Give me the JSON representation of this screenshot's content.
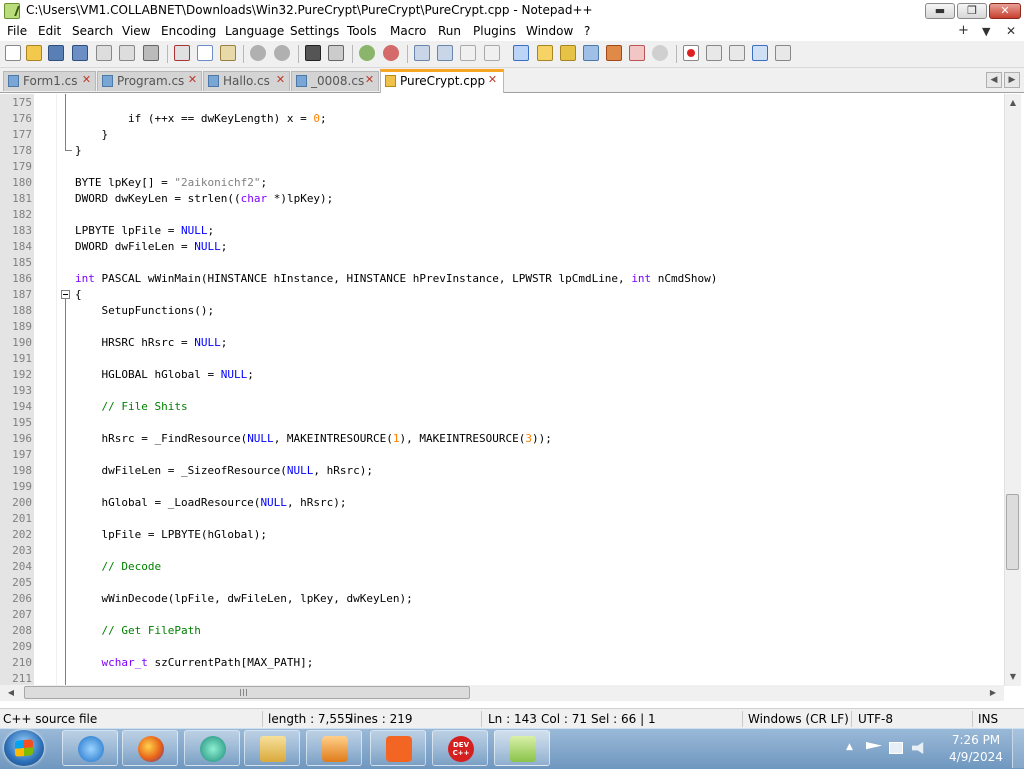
{
  "window": {
    "title": "C:\\Users\\VM1.COLLABNET\\Downloads\\Win32.PureCrypt\\PureCrypt\\PureCrypt.cpp - Notepad++",
    "min_label": "▬",
    "max_label": "❐",
    "close_label": "✕"
  },
  "menu": {
    "items": [
      "File",
      "Edit",
      "Search",
      "View",
      "Encoding",
      "Language",
      "Settings",
      "Tools",
      "Macro",
      "Run",
      "Plugins",
      "Window",
      "?"
    ],
    "right_plus": "+",
    "right_down": "▼",
    "right_close": "✕"
  },
  "tabs": [
    {
      "label": "Form1.cs",
      "active": false
    },
    {
      "label": "Program.cs",
      "active": false
    },
    {
      "label": "Hallo.cs",
      "active": false
    },
    {
      "label": "_0008.cs",
      "active": false
    },
    {
      "label": "PureCrypt.cpp",
      "active": true
    }
  ],
  "tab_close_glyph": "✕",
  "tab_scroll": {
    "left": "◀",
    "right": "▶"
  },
  "editor": {
    "line_numbers": [
      "175",
      "176",
      "177",
      "178",
      "179",
      "180",
      "181",
      "182",
      "183",
      "184",
      "185",
      "186",
      "187",
      "188",
      "189",
      "190",
      "191",
      "192",
      "193",
      "194",
      "195",
      "196",
      "197",
      "198",
      "199",
      "200",
      "201",
      "202",
      "203",
      "204",
      "205",
      "206",
      "207",
      "208",
      "209",
      "210",
      "211"
    ],
    "lines": [
      [],
      [
        {
          "t": "        if (++x == dwKeyLength) x = ",
          "c": ""
        },
        {
          "t": "0",
          "c": "num"
        },
        {
          "t": ";",
          "c": ""
        }
      ],
      [
        {
          "t": "    }",
          "c": ""
        }
      ],
      [
        {
          "t": "}",
          "c": ""
        }
      ],
      [],
      [
        {
          "t": "BYTE lpKey[] = ",
          "c": ""
        },
        {
          "t": "\"2aikonichf2\"",
          "c": "str"
        },
        {
          "t": ";",
          "c": ""
        }
      ],
      [
        {
          "t": "DWORD dwKeyLen = strlen((",
          "c": ""
        },
        {
          "t": "char",
          "c": "kw"
        },
        {
          "t": " *)lpKey);",
          "c": ""
        }
      ],
      [],
      [
        {
          "t": "LPBYTE lpFile = ",
          "c": ""
        },
        {
          "t": "NULL",
          "c": "nul"
        },
        {
          "t": ";",
          "c": ""
        }
      ],
      [
        {
          "t": "DWORD dwFileLen = ",
          "c": ""
        },
        {
          "t": "NULL",
          "c": "nul"
        },
        {
          "t": ";",
          "c": ""
        }
      ],
      [],
      [
        {
          "t": "int",
          "c": "kw"
        },
        {
          "t": " PASCAL wWinMain(HINSTANCE hInstance, HINSTANCE hPrevInstance, LPWSTR lpCmdLine, ",
          "c": ""
        },
        {
          "t": "int",
          "c": "kw"
        },
        {
          "t": " nCmdShow)",
          "c": ""
        }
      ],
      [
        {
          "t": "{",
          "c": ""
        }
      ],
      [
        {
          "t": "    SetupFunctions();",
          "c": ""
        }
      ],
      [],
      [
        {
          "t": "    HRSRC hRsrc = ",
          "c": ""
        },
        {
          "t": "NULL",
          "c": "nul"
        },
        {
          "t": ";",
          "c": ""
        }
      ],
      [],
      [
        {
          "t": "    HGLOBAL hGlobal = ",
          "c": ""
        },
        {
          "t": "NULL",
          "c": "nul"
        },
        {
          "t": ";",
          "c": ""
        }
      ],
      [],
      [
        {
          "t": "    // File Shits",
          "c": "cmt"
        }
      ],
      [],
      [
        {
          "t": "    hRsrc = _FindResource(",
          "c": ""
        },
        {
          "t": "NULL",
          "c": "nul"
        },
        {
          "t": ", MAKEINTRESOURCE(",
          "c": ""
        },
        {
          "t": "1",
          "c": "num"
        },
        {
          "t": "), MAKEINTRESOURCE(",
          "c": ""
        },
        {
          "t": "3",
          "c": "num"
        },
        {
          "t": "));",
          "c": ""
        }
      ],
      [],
      [
        {
          "t": "    dwFileLen = _SizeofResource(",
          "c": ""
        },
        {
          "t": "NULL",
          "c": "nul"
        },
        {
          "t": ", hRsrc);",
          "c": ""
        }
      ],
      [],
      [
        {
          "t": "    hGlobal = _LoadResource(",
          "c": ""
        },
        {
          "t": "NULL",
          "c": "nul"
        },
        {
          "t": ", hRsrc);",
          "c": ""
        }
      ],
      [],
      [
        {
          "t": "    lpFile = LPBYTE(hGlobal);",
          "c": ""
        }
      ],
      [],
      [
        {
          "t": "    // Decode",
          "c": "cmt"
        }
      ],
      [],
      [
        {
          "t": "    wWinDecode(lpFile, dwFileLen, lpKey, dwKeyLen);",
          "c": ""
        }
      ],
      [],
      [
        {
          "t": "    // Get FilePath",
          "c": "cmt"
        }
      ],
      [],
      [
        {
          "t": "    ",
          "c": ""
        },
        {
          "t": "wchar_t",
          "c": "kw"
        },
        {
          "t": " szCurrentPath[MAX_PATH];",
          "c": ""
        }
      ],
      []
    ]
  },
  "scroll": {
    "up": "▲",
    "down": "▼",
    "left": "◀",
    "right": "▶"
  },
  "status": {
    "file_type": "C++ source file",
    "length": "length : 7,555",
    "lines": "lines : 219",
    "ln": "Ln : 143",
    "col": "Col : 71",
    "sel": "Sel : 66 | 1",
    "eol": "Windows (CR LF)",
    "encoding": "UTF-8",
    "mode": "INS"
  },
  "taskbar": {
    "devcpp_label": "DEV C++",
    "tray_up": "▲",
    "time": "7:26 PM",
    "date": "4/9/2024"
  },
  "colors": {
    "accent_tab": "#f6a623",
    "keyword": "#8000ff",
    "null_kw": "#0000ff",
    "number": "#ff8000",
    "string": "#808080",
    "comment": "#008000"
  }
}
